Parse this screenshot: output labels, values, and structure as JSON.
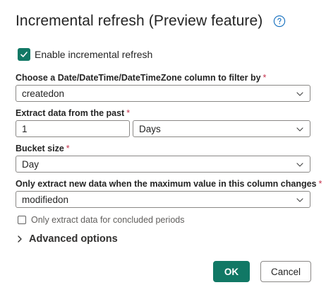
{
  "dialog": {
    "title": "Incremental refresh (Preview feature)",
    "help_icon": "question-circle-icon"
  },
  "enable": {
    "label": "Enable incremental refresh",
    "checked": true
  },
  "date_column": {
    "label": "Choose a Date/DateTime/DateTimeZone column to filter by",
    "required_mark": "*",
    "value": "createdon"
  },
  "extract_past": {
    "label": "Extract data from the past",
    "required_mark": "*",
    "number_value": "1",
    "unit_value": "Days"
  },
  "bucket_size": {
    "label": "Bucket size",
    "required_mark": "*",
    "value": "Day"
  },
  "change_column": {
    "label": "Only extract new data when the maximum value in this column changes",
    "required_mark": "*",
    "value": "modifiedon"
  },
  "concluded": {
    "label": "Only extract data for concluded periods",
    "checked": false
  },
  "advanced": {
    "label": "Advanced options"
  },
  "buttons": {
    "ok": "OK",
    "cancel": "Cancel"
  },
  "colors": {
    "accent": "#117865",
    "required": "#c4314b",
    "help": "#0f6cbd"
  }
}
